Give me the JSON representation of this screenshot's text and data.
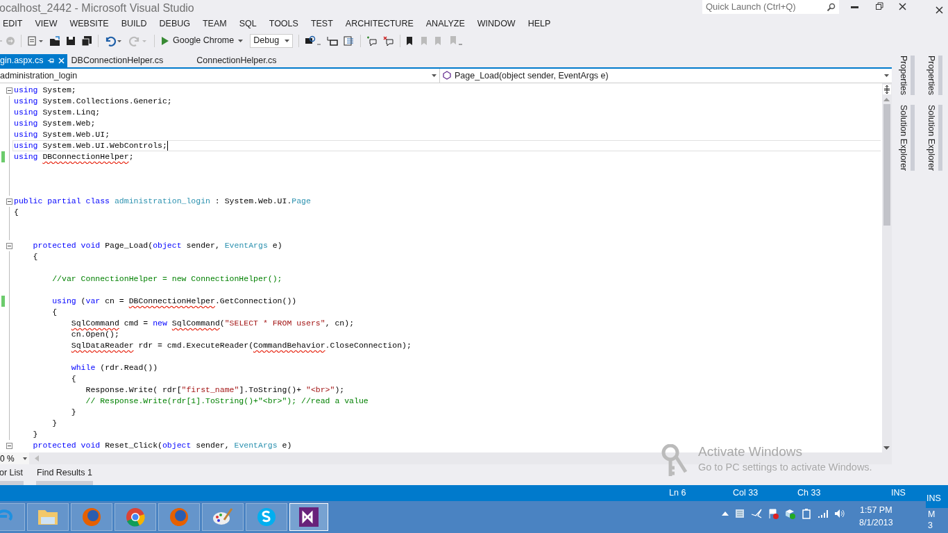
{
  "window": {
    "title": "ocalhost_2442 - Microsoft Visual Studio",
    "quick_launch": {
      "placeholder": "Quick Launch (Ctrl+Q)"
    }
  },
  "menu": [
    "EDIT",
    "VIEW",
    "WEBSITE",
    "BUILD",
    "DEBUG",
    "TEAM",
    "SQL",
    "TOOLS",
    "TEST",
    "ARCHITECTURE",
    "ANALYZE",
    "WINDOW",
    "HELP"
  ],
  "toolbar": {
    "browser": "Google Chrome",
    "configuration": "Debug"
  },
  "tabs": [
    {
      "label": "gin.aspx.cs",
      "selected": true
    },
    {
      "label": "DBConnectionHelper.cs",
      "selected": false
    },
    {
      "label": "ConnectionHelper.cs",
      "selected": false
    }
  ],
  "navigation": {
    "type_dropdown": "administration_login",
    "member_dropdown": "Page_Load(object sender, EventArgs e)"
  },
  "code_lines": [
    {
      "kind": "code",
      "fold": true,
      "tokens": [
        {
          "kind": "kw",
          "text": "using"
        },
        {
          "kind": "plain",
          "text": " System;"
        }
      ]
    },
    {
      "kind": "code",
      "tokens": [
        {
          "kind": "kw",
          "text": "using"
        },
        {
          "kind": "plain",
          "text": " System.Collections.Generic;"
        }
      ]
    },
    {
      "kind": "code",
      "tokens": [
        {
          "kind": "kw",
          "text": "using"
        },
        {
          "kind": "plain",
          "text": " System.Linq;"
        }
      ]
    },
    {
      "kind": "code",
      "tokens": [
        {
          "kind": "kw",
          "text": "using"
        },
        {
          "kind": "plain",
          "text": " System.Web;"
        }
      ]
    },
    {
      "kind": "code",
      "tokens": [
        {
          "kind": "kw",
          "text": "using"
        },
        {
          "kind": "plain",
          "text": " System.Web.UI;"
        }
      ]
    },
    {
      "kind": "code",
      "current": true,
      "tokens": [
        {
          "kind": "kw",
          "text": "using"
        },
        {
          "kind": "plain",
          "text": " System.Web.UI.WebControls;"
        }
      ]
    },
    {
      "kind": "code",
      "changed": true,
      "tokens": [
        {
          "kind": "kw",
          "text": "using "
        },
        {
          "kind": "plain",
          "text": "DBConnectionHelper",
          "error": true
        },
        {
          "kind": "plain",
          "text": ";"
        }
      ]
    },
    {
      "kind": "blank"
    },
    {
      "kind": "blank"
    },
    {
      "kind": "blank"
    },
    {
      "kind": "code",
      "fold": true,
      "tokens": [
        {
          "kind": "kw",
          "text": "public partial class "
        },
        {
          "kind": "type",
          "text": "administration_login"
        },
        {
          "kind": "plain",
          "text": " : System.Web.UI."
        },
        {
          "kind": "type",
          "text": "Page"
        }
      ]
    },
    {
      "kind": "code",
      "tokens": [
        {
          "kind": "plain",
          "text": "{"
        }
      ]
    },
    {
      "kind": "blank"
    },
    {
      "kind": "blank"
    },
    {
      "kind": "code",
      "fold": true,
      "tokens": [
        {
          "kind": "kw",
          "text": "    protected void"
        },
        {
          "kind": "plain",
          "text": " Page_Load("
        },
        {
          "kind": "kw",
          "text": "object"
        },
        {
          "kind": "plain",
          "text": " sender, "
        },
        {
          "kind": "type",
          "text": "EventArgs"
        },
        {
          "kind": "plain",
          "text": " e)"
        }
      ]
    },
    {
      "kind": "code",
      "tokens": [
        {
          "kind": "plain",
          "text": "    {"
        }
      ]
    },
    {
      "kind": "blank"
    },
    {
      "kind": "code",
      "tokens": [
        {
          "kind": "cmt",
          "text": "        //var ConnectionHelper = new ConnectionHelper();"
        }
      ]
    },
    {
      "kind": "blank"
    },
    {
      "kind": "code",
      "changed": true,
      "tokens": [
        {
          "kind": "kw",
          "text": "        using"
        },
        {
          "kind": "plain",
          "text": " ("
        },
        {
          "kind": "kw",
          "text": "var"
        },
        {
          "kind": "plain",
          "text": " cn = "
        },
        {
          "kind": "plain",
          "text": "DBConnectionHelper",
          "error": true
        },
        {
          "kind": "plain",
          "text": ".GetConnection())"
        }
      ]
    },
    {
      "kind": "code",
      "tokens": [
        {
          "kind": "plain",
          "text": "        {"
        }
      ]
    },
    {
      "kind": "code",
      "tokens": [
        {
          "kind": "plain",
          "text": "            SqlCommand",
          "error": true
        },
        {
          "kind": "plain",
          "text": " cmd = "
        },
        {
          "kind": "kw",
          "text": "new "
        },
        {
          "kind": "plain",
          "text": "SqlCommand",
          "error": true
        },
        {
          "kind": "plain",
          "text": "("
        },
        {
          "kind": "str",
          "text": "\"SELECT * FROM users\""
        },
        {
          "kind": "plain",
          "text": ", cn);"
        }
      ]
    },
    {
      "kind": "code",
      "tokens": [
        {
          "kind": "plain",
          "text": "            cn.Open();"
        }
      ]
    },
    {
      "kind": "code",
      "tokens": [
        {
          "kind": "plain",
          "text": "            SqlDataReader",
          "error": true
        },
        {
          "kind": "plain",
          "text": " rdr = cmd.ExecuteReader("
        },
        {
          "kind": "plain",
          "text": "CommandBehavior",
          "error": true
        },
        {
          "kind": "plain",
          "text": ".CloseConnection);"
        }
      ]
    },
    {
      "kind": "blank"
    },
    {
      "kind": "code",
      "tokens": [
        {
          "kind": "kw",
          "text": "            while"
        },
        {
          "kind": "plain",
          "text": " (rdr.Read())"
        }
      ]
    },
    {
      "kind": "code",
      "tokens": [
        {
          "kind": "plain",
          "text": "            {"
        }
      ]
    },
    {
      "kind": "code",
      "tokens": [
        {
          "kind": "plain",
          "text": "               Response.Write( rdr["
        },
        {
          "kind": "str",
          "text": "\"first_name\""
        },
        {
          "kind": "plain",
          "text": "].ToString()+ "
        },
        {
          "kind": "str",
          "text": "\"<br>\""
        },
        {
          "kind": "plain",
          "text": ");"
        }
      ]
    },
    {
      "kind": "code",
      "tokens": [
        {
          "kind": "cmt",
          "text": "               // Response.Write(rdr[1].ToString()+\"<br>\"); //read a value"
        }
      ]
    },
    {
      "kind": "code",
      "tokens": [
        {
          "kind": "plain",
          "text": "            }"
        }
      ]
    },
    {
      "kind": "code",
      "tokens": [
        {
          "kind": "plain",
          "text": "        }"
        }
      ]
    },
    {
      "kind": "code",
      "tokens": [
        {
          "kind": "plain",
          "text": "    }"
        }
      ]
    },
    {
      "kind": "code",
      "fold": true,
      "tokens": [
        {
          "kind": "kw",
          "text": "    protected void"
        },
        {
          "kind": "plain",
          "text": " Reset_Click("
        },
        {
          "kind": "kw",
          "text": "object"
        },
        {
          "kind": "plain",
          "text": " sender, "
        },
        {
          "kind": "type",
          "text": "EventArgs"
        },
        {
          "kind": "plain",
          "text": " e)"
        }
      ]
    }
  ],
  "zoom": "0 %",
  "side_panels": [
    {
      "tabs": [
        "Properties",
        "Solution Explorer"
      ]
    },
    {
      "tabs": [
        "Properties",
        "Solution Explorer"
      ]
    }
  ],
  "tool_tabs": [
    "or List",
    "Find Results 1"
  ],
  "activation": {
    "title": "Activate Windows",
    "message": "Go to PC settings to activate Windows."
  },
  "status_bar": {
    "line": "Ln 6",
    "column": "Col 33",
    "char": "Ch 33",
    "mode": "INS",
    "other_mode": "INS"
  },
  "taskbar": {
    "apps": [
      {
        "kind": "ie",
        "selected": false
      },
      {
        "kind": "folder",
        "selected": false
      },
      {
        "kind": "firefox",
        "selected": false
      },
      {
        "kind": "chrome",
        "selected": false
      },
      {
        "kind": "firefox",
        "selected": false
      },
      {
        "kind": "paint",
        "selected": false
      },
      {
        "kind": "skype",
        "selected": false
      },
      {
        "kind": "vs",
        "selected": true
      }
    ],
    "time": "1:57 PM",
    "date": "8/1/2013",
    "fragments": [
      "M",
      "3"
    ]
  }
}
